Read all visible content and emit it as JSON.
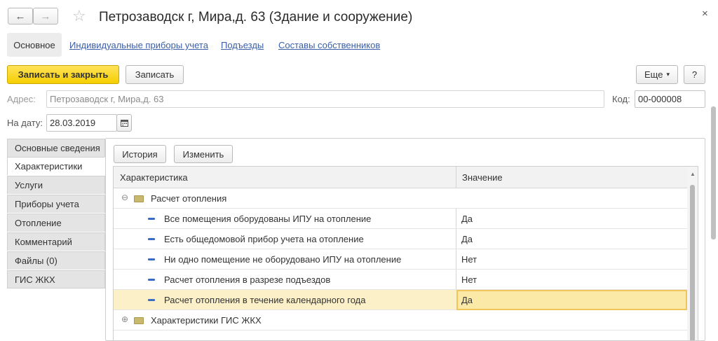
{
  "window": {
    "title": "Петрозаводск г, Мира,д. 63 (Здание и сооружение)",
    "back_icon": "←",
    "forward_icon": "→",
    "star_icon": "☆",
    "close_icon": "×"
  },
  "nav_tabs": [
    {
      "label": "Основное",
      "active": true
    },
    {
      "label": "Индивидуальные приборы учета"
    },
    {
      "label": "Подъезды"
    },
    {
      "label": "Составы собственников"
    }
  ],
  "toolbar": {
    "save_close_label": "Записать и закрыть",
    "save_label": "Записать",
    "more_label": "Еще",
    "more_caret": "▾",
    "help_label": "?"
  },
  "form": {
    "address_label": "Адрес:",
    "address_value": "Петрозаводск г, Мира,д. 63",
    "code_label": "Код:",
    "code_value": "00-000008",
    "date_label": "На дату:",
    "date_value": "28.03.2019"
  },
  "side_tabs": [
    {
      "label": "Основные сведения"
    },
    {
      "label": "Характеристики",
      "active": true
    },
    {
      "label": "Услуги"
    },
    {
      "label": "Приборы учета"
    },
    {
      "label": "Отопление"
    },
    {
      "label": "Комментарий"
    },
    {
      "label": "Файлы (0)"
    },
    {
      "label": "ГИС ЖКХ"
    }
  ],
  "panel": {
    "history_label": "История",
    "edit_label": "Изменить",
    "columns": [
      "Характеристика",
      "Значение"
    ],
    "rows": [
      {
        "type": "group",
        "expanded": true,
        "toggle": "⊖",
        "name": "Расчет отопления",
        "value": ""
      },
      {
        "type": "item",
        "name": "Все помещения оборудованы ИПУ на отопление",
        "value": "Да"
      },
      {
        "type": "item",
        "name": "Есть общедомовой прибор учета на отопление",
        "value": "Да"
      },
      {
        "type": "item",
        "name": "Ни одно помещение не оборудовано ИПУ на отопление",
        "value": "Нет"
      },
      {
        "type": "item",
        "name": "Расчет отопления в разрезе подъездов",
        "value": "Нет"
      },
      {
        "type": "item",
        "name": "Расчет отопления в течение календарного года",
        "value": "Да",
        "selected": true
      },
      {
        "type": "group",
        "expanded": false,
        "toggle": "⊕",
        "name": "Характеристики ГИС ЖКХ",
        "value": ""
      }
    ]
  },
  "colors": {
    "primary_button": "#f5cf00",
    "link": "#3a5ea8",
    "selected_row": "#fbf0c8",
    "selected_cell_border": "#f0c65a"
  }
}
